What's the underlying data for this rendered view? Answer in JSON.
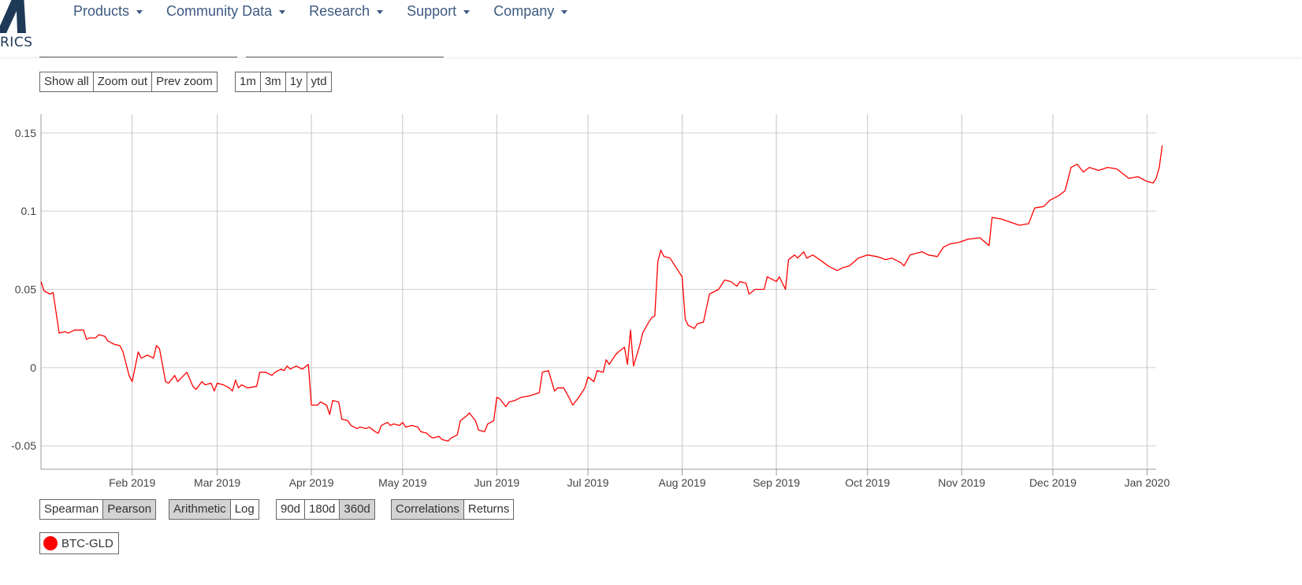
{
  "brand": {
    "word": "RICS"
  },
  "nav": {
    "items": [
      {
        "label": "Products"
      },
      {
        "label": "Community Data"
      },
      {
        "label": "Research"
      },
      {
        "label": "Support"
      },
      {
        "label": "Company"
      }
    ]
  },
  "zoom_controls": {
    "show_all": "Show all",
    "zoom_out": "Zoom out",
    "prev_zoom": "Prev zoom"
  },
  "range_controls": {
    "r1m": "1m",
    "r3m": "3m",
    "r1y": "1y",
    "rytd": "ytd"
  },
  "method_controls": {
    "spearman": "Spearman",
    "pearson": "Pearson",
    "active": "Pearson"
  },
  "scale_controls": {
    "arithmetic": "Arithmetic",
    "log": "Log",
    "active": "Arithmetic"
  },
  "window_controls": {
    "w90": "90d",
    "w180": "180d",
    "w360": "360d",
    "active": "360d"
  },
  "view_controls": {
    "correlations": "Correlations",
    "returns": "Returns",
    "active": "Correlations"
  },
  "legend": {
    "label": "BTC-GLD",
    "color": "#ff0000"
  },
  "colors": {
    "line": "#ff0000",
    "grid": "#cfcfcf",
    "nav": "#3d5a80",
    "brand": "#1f3a57"
  },
  "chart_data": {
    "type": "line",
    "title": "",
    "xlabel": "",
    "ylabel": "",
    "x_range": [
      "2019-01-02",
      "2020-01-04"
    ],
    "ylim": [
      -0.065,
      0.162
    ],
    "y_ticks": [
      {
        "value": 0.15,
        "label": "0.15"
      },
      {
        "value": 0.1,
        "label": "0.1"
      },
      {
        "value": 0.05,
        "label": "0.05"
      },
      {
        "value": 0,
        "label": "0"
      },
      {
        "value": -0.05,
        "label": "-0.05"
      }
    ],
    "x_ticks": [
      {
        "date": "2019-02-01",
        "label": "Feb 2019"
      },
      {
        "date": "2019-03-01",
        "label": "Mar 2019"
      },
      {
        "date": "2019-04-01",
        "label": "Apr 2019"
      },
      {
        "date": "2019-05-01",
        "label": "May 2019"
      },
      {
        "date": "2019-06-01",
        "label": "Jun 2019"
      },
      {
        "date": "2019-07-01",
        "label": "Jul 2019"
      },
      {
        "date": "2019-08-01",
        "label": "Aug 2019"
      },
      {
        "date": "2019-09-01",
        "label": "Sep 2019"
      },
      {
        "date": "2019-10-01",
        "label": "Oct 2019"
      },
      {
        "date": "2019-11-01",
        "label": "Nov 2019"
      },
      {
        "date": "2019-12-01",
        "label": "Dec 2019"
      },
      {
        "date": "2020-01-01",
        "label": "Jan 2020"
      }
    ],
    "grid": true,
    "series": [
      {
        "name": "BTC-GLD",
        "color": "#ff0000",
        "points": [
          [
            "2019-01-02",
            0.055
          ],
          [
            "2019-01-03",
            0.049
          ],
          [
            "2019-01-05",
            0.047
          ],
          [
            "2019-01-06",
            0.048
          ],
          [
            "2019-01-08",
            0.022
          ],
          [
            "2019-01-10",
            0.023
          ],
          [
            "2019-01-11",
            0.022
          ],
          [
            "2019-01-13",
            0.024
          ],
          [
            "2019-01-16",
            0.024
          ],
          [
            "2019-01-17",
            0.018
          ],
          [
            "2019-01-18",
            0.019
          ],
          [
            "2019-01-20",
            0.019
          ],
          [
            "2019-01-21",
            0.021
          ],
          [
            "2019-01-23",
            0.02
          ],
          [
            "2019-01-24",
            0.017
          ],
          [
            "2019-01-26",
            0.015
          ],
          [
            "2019-01-28",
            0.014
          ],
          [
            "2019-01-29",
            0.01
          ],
          [
            "2019-01-31",
            -0.005
          ],
          [
            "2019-02-01",
            -0.009
          ],
          [
            "2019-02-03",
            0.01
          ],
          [
            "2019-02-04",
            0.006
          ],
          [
            "2019-02-06",
            0.008
          ],
          [
            "2019-02-08",
            0.006
          ],
          [
            "2019-02-09",
            0.014
          ],
          [
            "2019-02-10",
            0.012
          ],
          [
            "2019-02-12",
            -0.009
          ],
          [
            "2019-02-13",
            -0.01
          ],
          [
            "2019-02-15",
            -0.005
          ],
          [
            "2019-02-16",
            -0.009
          ],
          [
            "2019-02-18",
            -0.005
          ],
          [
            "2019-02-19",
            -0.003
          ],
          [
            "2019-02-21",
            -0.012
          ],
          [
            "2019-02-22",
            -0.014
          ],
          [
            "2019-02-24",
            -0.009
          ],
          [
            "2019-02-25",
            -0.011
          ],
          [
            "2019-02-27",
            -0.01
          ],
          [
            "2019-02-28",
            -0.015
          ],
          [
            "2019-03-01",
            -0.01
          ],
          [
            "2019-03-03",
            -0.011
          ],
          [
            "2019-03-05",
            -0.013
          ],
          [
            "2019-03-06",
            -0.015
          ],
          [
            "2019-03-07",
            -0.008
          ],
          [
            "2019-03-08",
            -0.013
          ],
          [
            "2019-03-09",
            -0.011
          ],
          [
            "2019-03-11",
            -0.013
          ],
          [
            "2019-03-14",
            -0.012
          ],
          [
            "2019-03-15",
            -0.003
          ],
          [
            "2019-03-17",
            -0.003
          ],
          [
            "2019-03-19",
            -0.005
          ],
          [
            "2019-03-20",
            -0.003
          ],
          [
            "2019-03-22",
            -0.001
          ],
          [
            "2019-03-23",
            -0.002
          ],
          [
            "2019-03-24",
            0.001
          ],
          [
            "2019-03-25",
            -0.001
          ],
          [
            "2019-03-27",
            0.001
          ],
          [
            "2019-03-29",
            -0.001
          ],
          [
            "2019-03-31",
            0.002
          ],
          [
            "2019-04-01",
            -0.024
          ],
          [
            "2019-04-03",
            -0.024
          ],
          [
            "2019-04-04",
            -0.022
          ],
          [
            "2019-04-06",
            -0.024
          ],
          [
            "2019-04-07",
            -0.03
          ],
          [
            "2019-04-08",
            -0.021
          ],
          [
            "2019-04-10",
            -0.022
          ],
          [
            "2019-04-11",
            -0.033
          ],
          [
            "2019-04-13",
            -0.034
          ],
          [
            "2019-04-14",
            -0.037
          ],
          [
            "2019-04-16",
            -0.039
          ],
          [
            "2019-04-17",
            -0.038
          ],
          [
            "2019-04-19",
            -0.039
          ],
          [
            "2019-04-20",
            -0.038
          ],
          [
            "2019-04-22",
            -0.041
          ],
          [
            "2019-04-23",
            -0.042
          ],
          [
            "2019-04-24",
            -0.037
          ],
          [
            "2019-04-26",
            -0.035
          ],
          [
            "2019-04-27",
            -0.037
          ],
          [
            "2019-04-28",
            -0.036
          ],
          [
            "2019-04-30",
            -0.037
          ],
          [
            "2019-05-01",
            -0.035
          ],
          [
            "2019-05-02",
            -0.038
          ],
          [
            "2019-05-04",
            -0.037
          ],
          [
            "2019-05-06",
            -0.038
          ],
          [
            "2019-05-07",
            -0.041
          ],
          [
            "2019-05-09",
            -0.042
          ],
          [
            "2019-05-10",
            -0.044
          ],
          [
            "2019-05-11",
            -0.045
          ],
          [
            "2019-05-13",
            -0.044
          ],
          [
            "2019-05-14",
            -0.046
          ],
          [
            "2019-05-16",
            -0.047
          ],
          [
            "2019-05-17",
            -0.045
          ],
          [
            "2019-05-19",
            -0.043
          ],
          [
            "2019-05-20",
            -0.034
          ],
          [
            "2019-05-22",
            -0.031
          ],
          [
            "2019-05-23",
            -0.029
          ],
          [
            "2019-05-25",
            -0.034
          ],
          [
            "2019-05-26",
            -0.04
          ],
          [
            "2019-05-28",
            -0.041
          ],
          [
            "2019-05-29",
            -0.036
          ],
          [
            "2019-05-31",
            -0.034
          ],
          [
            "2019-06-01",
            -0.019
          ],
          [
            "2019-06-02",
            -0.02
          ],
          [
            "2019-06-04",
            -0.025
          ],
          [
            "2019-06-05",
            -0.022
          ],
          [
            "2019-06-07",
            -0.021
          ],
          [
            "2019-06-09",
            -0.019
          ],
          [
            "2019-06-12",
            -0.018
          ],
          [
            "2019-06-15",
            -0.016
          ],
          [
            "2019-06-16",
            -0.003
          ],
          [
            "2019-06-18",
            -0.002
          ],
          [
            "2019-06-20",
            -0.015
          ],
          [
            "2019-06-21",
            -0.013
          ],
          [
            "2019-06-23",
            -0.013
          ],
          [
            "2019-06-25",
            -0.02
          ],
          [
            "2019-06-26",
            -0.024
          ],
          [
            "2019-06-28",
            -0.019
          ],
          [
            "2019-06-30",
            -0.013
          ],
          [
            "2019-07-01",
            -0.006
          ],
          [
            "2019-07-03",
            -0.009
          ],
          [
            "2019-07-04",
            -0.002
          ],
          [
            "2019-07-06",
            -0.003
          ],
          [
            "2019-07-07",
            0.005
          ],
          [
            "2019-07-08",
            0.002
          ],
          [
            "2019-07-10",
            0.008
          ],
          [
            "2019-07-11",
            0.01
          ],
          [
            "2019-07-13",
            0.013
          ],
          [
            "2019-07-14",
            0.002
          ],
          [
            "2019-07-15",
            0.024
          ],
          [
            "2019-07-16",
            0.001
          ],
          [
            "2019-07-18",
            0.014
          ],
          [
            "2019-07-19",
            0.022
          ],
          [
            "2019-07-21",
            0.029
          ],
          [
            "2019-07-22",
            0.032
          ],
          [
            "2019-07-23",
            0.033
          ],
          [
            "2019-07-24",
            0.068
          ],
          [
            "2019-07-25",
            0.075
          ],
          [
            "2019-07-26",
            0.071
          ],
          [
            "2019-07-28",
            0.07
          ],
          [
            "2019-07-30",
            0.064
          ],
          [
            "2019-08-01",
            0.058
          ],
          [
            "2019-08-02",
            0.031
          ],
          [
            "2019-08-03",
            0.027
          ],
          [
            "2019-08-05",
            0.025
          ],
          [
            "2019-08-06",
            0.028
          ],
          [
            "2019-08-08",
            0.029
          ],
          [
            "2019-08-10",
            0.047
          ],
          [
            "2019-08-12",
            0.049
          ],
          [
            "2019-08-13",
            0.05
          ],
          [
            "2019-08-15",
            0.056
          ],
          [
            "2019-08-17",
            0.055
          ],
          [
            "2019-08-19",
            0.052
          ],
          [
            "2019-08-20",
            0.055
          ],
          [
            "2019-08-22",
            0.054
          ],
          [
            "2019-08-23",
            0.047
          ],
          [
            "2019-08-25",
            0.05
          ],
          [
            "2019-08-28",
            0.05
          ],
          [
            "2019-08-29",
            0.058
          ],
          [
            "2019-09-01",
            0.055
          ],
          [
            "2019-09-02",
            0.058
          ],
          [
            "2019-09-04",
            0.05
          ],
          [
            "2019-09-05",
            0.069
          ],
          [
            "2019-09-07",
            0.072
          ],
          [
            "2019-09-08",
            0.07
          ],
          [
            "2019-09-10",
            0.074
          ],
          [
            "2019-09-11",
            0.07
          ],
          [
            "2019-09-13",
            0.072
          ],
          [
            "2019-09-16",
            0.068
          ],
          [
            "2019-09-18",
            0.065
          ],
          [
            "2019-09-21",
            0.062
          ],
          [
            "2019-09-23",
            0.064
          ],
          [
            "2019-09-25",
            0.065
          ],
          [
            "2019-09-28",
            0.07
          ],
          [
            "2019-10-01",
            0.072
          ],
          [
            "2019-10-04",
            0.071
          ],
          [
            "2019-10-07",
            0.069
          ],
          [
            "2019-10-09",
            0.07
          ],
          [
            "2019-10-12",
            0.067
          ],
          [
            "2019-10-13",
            0.065
          ],
          [
            "2019-10-15",
            0.072
          ],
          [
            "2019-10-17",
            0.073
          ],
          [
            "2019-10-19",
            0.074
          ],
          [
            "2019-10-21",
            0.072
          ],
          [
            "2019-10-24",
            0.071
          ],
          [
            "2019-10-26",
            0.077
          ],
          [
            "2019-10-28",
            0.079
          ],
          [
            "2019-10-31",
            0.08
          ],
          [
            "2019-11-03",
            0.082
          ],
          [
            "2019-11-07",
            0.083
          ],
          [
            "2019-11-10",
            0.078
          ],
          [
            "2019-11-11",
            0.096
          ],
          [
            "2019-11-14",
            0.095
          ],
          [
            "2019-11-17",
            0.093
          ],
          [
            "2019-11-20",
            0.091
          ],
          [
            "2019-11-23",
            0.092
          ],
          [
            "2019-11-25",
            0.102
          ],
          [
            "2019-11-28",
            0.103
          ],
          [
            "2019-11-30",
            0.107
          ],
          [
            "2019-12-03",
            0.11
          ],
          [
            "2019-12-05",
            0.113
          ],
          [
            "2019-12-07",
            0.128
          ],
          [
            "2019-12-09",
            0.13
          ],
          [
            "2019-12-11",
            0.125
          ],
          [
            "2019-12-13",
            0.128
          ],
          [
            "2019-12-16",
            0.126
          ],
          [
            "2019-12-19",
            0.128
          ],
          [
            "2019-12-22",
            0.127
          ],
          [
            "2019-12-24",
            0.124
          ],
          [
            "2019-12-26",
            0.121
          ],
          [
            "2019-12-29",
            0.122
          ],
          [
            "2020-01-01",
            0.119
          ],
          [
            "2020-01-03",
            0.118
          ],
          [
            "2020-01-04",
            0.121
          ],
          [
            "2020-01-05",
            0.128
          ],
          [
            "2020-01-06",
            0.142
          ]
        ]
      }
    ]
  }
}
